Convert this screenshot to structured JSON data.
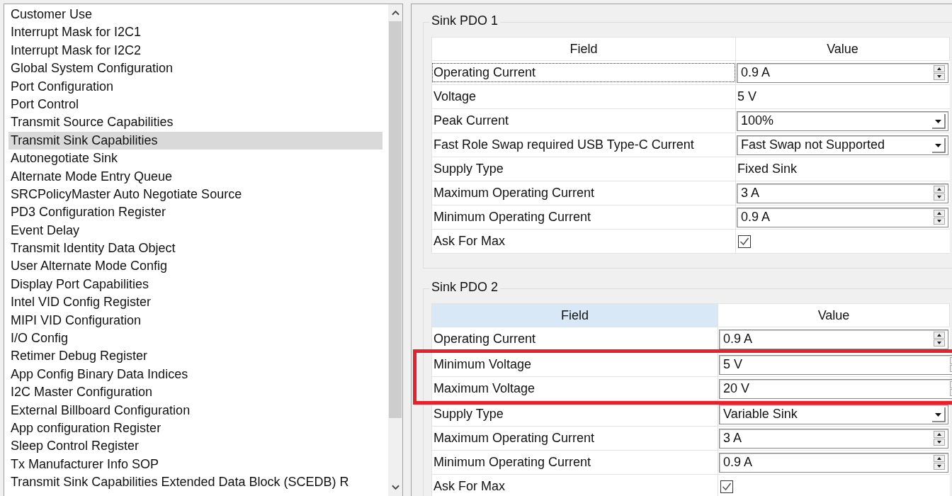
{
  "settings_list": {
    "items": [
      {
        "label": "Customer Use",
        "selected": false
      },
      {
        "label": "Interrupt Mask for I2C1",
        "selected": false
      },
      {
        "label": "Interrupt Mask for I2C2",
        "selected": false
      },
      {
        "label": "Global System Configuration",
        "selected": false
      },
      {
        "label": "Port Configuration",
        "selected": false
      },
      {
        "label": "Port Control",
        "selected": false
      },
      {
        "label": "Transmit Source Capabilities",
        "selected": false
      },
      {
        "label": "Transmit Sink Capabilities",
        "selected": true
      },
      {
        "label": "Autonegotiate Sink",
        "selected": false
      },
      {
        "label": "Alternate Mode Entry Queue",
        "selected": false
      },
      {
        "label": "SRCPolicyMaster Auto Negotiate Source",
        "selected": false
      },
      {
        "label": "PD3 Configuration Register",
        "selected": false
      },
      {
        "label": "Event Delay",
        "selected": false
      },
      {
        "label": "Transmit Identity Data Object",
        "selected": false
      },
      {
        "label": "User Alternate Mode Config",
        "selected": false
      },
      {
        "label": "Display Port Capabilities",
        "selected": false
      },
      {
        "label": "Intel VID Config Register",
        "selected": false
      },
      {
        "label": "MIPI VID Configuration",
        "selected": false
      },
      {
        "label": "I/O Config",
        "selected": false
      },
      {
        "label": "Retimer Debug Register",
        "selected": false
      },
      {
        "label": "App Config Binary Data Indices",
        "selected": false
      },
      {
        "label": "I2C Master Configuration",
        "selected": false
      },
      {
        "label": "External Billboard Configuration",
        "selected": false
      },
      {
        "label": "App configuration Register",
        "selected": false
      },
      {
        "label": "Sleep Control Register",
        "selected": false
      },
      {
        "label": "Tx Manufacturer Info SOP",
        "selected": false
      },
      {
        "label": "Transmit Sink Capabilities Extended Data Block (SCEDB) R",
        "selected": false
      }
    ]
  },
  "groups": [
    {
      "title": "Sink PDO 1",
      "columns": [
        {
          "label": "Field",
          "selected": false
        },
        {
          "label": "Value",
          "selected": false
        }
      ],
      "sections": [
        {
          "highlighted": false,
          "rows": [
            {
              "field": "Operating Current",
              "focused": true,
              "kind": "spin",
              "value": "0.9 A"
            },
            {
              "field": "Voltage",
              "focused": false,
              "kind": "text",
              "value": "5 V"
            },
            {
              "field": "Peak Current",
              "focused": false,
              "kind": "dropdown",
              "value": "100%"
            },
            {
              "field": "Fast Role Swap required USB Type-C Current",
              "focused": false,
              "kind": "dropdown",
              "value": "Fast Swap not Supported"
            },
            {
              "field": "Supply Type",
              "focused": false,
              "kind": "text",
              "value": "Fixed Sink"
            },
            {
              "field": "Maximum Operating Current",
              "focused": false,
              "kind": "spin",
              "value": "3 A"
            },
            {
              "field": "Minimum Operating Current",
              "focused": false,
              "kind": "spin",
              "value": "0.9 A"
            },
            {
              "field": "Ask For Max",
              "focused": false,
              "kind": "checkbox",
              "checked": true
            }
          ]
        }
      ]
    },
    {
      "title": "Sink PDO 2",
      "columns": [
        {
          "label": "Field",
          "selected": true
        },
        {
          "label": "Value",
          "selected": false
        }
      ],
      "sections": [
        {
          "highlighted": false,
          "rows": [
            {
              "field": "Operating Current",
              "focused": false,
              "kind": "spin",
              "value": "0.9 A"
            }
          ]
        },
        {
          "highlighted": true,
          "rows": [
            {
              "field": "Minimum Voltage",
              "focused": false,
              "kind": "spin",
              "value": "5 V"
            },
            {
              "field": "Maximum Voltage",
              "focused": false,
              "kind": "spin",
              "value": "20 V"
            }
          ]
        },
        {
          "highlighted": false,
          "rows": [
            {
              "field": "Supply Type",
              "focused": false,
              "kind": "dropdown",
              "value": "Variable Sink"
            },
            {
              "field": "Maximum Operating Current",
              "focused": false,
              "kind": "spin",
              "value": "3 A"
            },
            {
              "field": "Minimum Operating Current",
              "focused": false,
              "kind": "spin",
              "value": "0.9 A"
            },
            {
              "field": "Ask For Max",
              "focused": false,
              "kind": "checkbox",
              "checked": true
            }
          ]
        }
      ]
    }
  ]
}
